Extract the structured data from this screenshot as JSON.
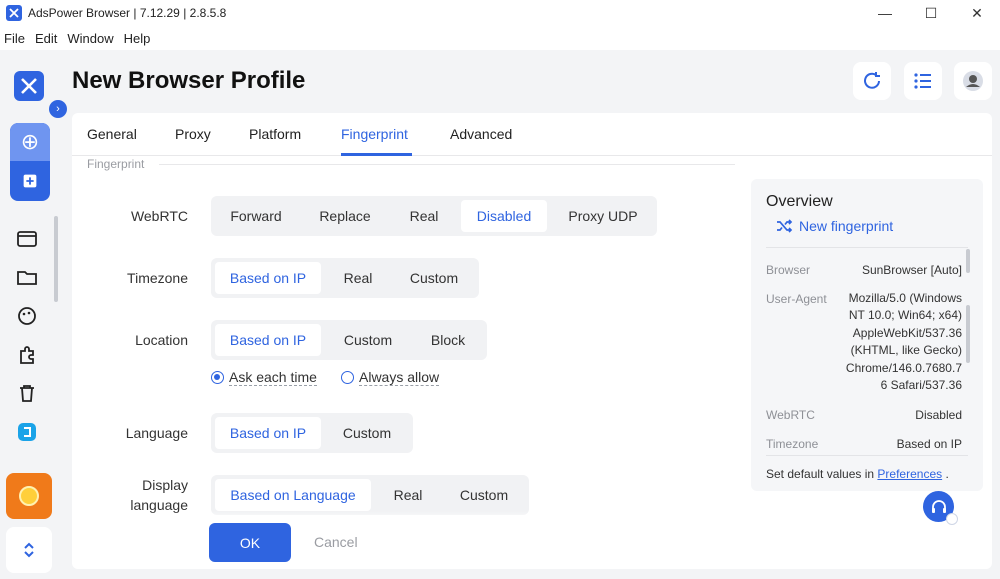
{
  "window": {
    "title": "AdsPower Browser | 7.12.29 | 2.8.5.8"
  },
  "menu": [
    "File",
    "Edit",
    "Window",
    "Help"
  ],
  "header": {
    "title": "New Browser Profile"
  },
  "tabs": [
    "General",
    "Proxy",
    "Platform",
    "Fingerprint",
    "Advanced"
  ],
  "active_tab": "Fingerprint",
  "section_label": "Fingerprint",
  "rows": {
    "webrtc": {
      "label": "WebRTC",
      "options": [
        "Forward",
        "Replace",
        "Real",
        "Disabled",
        "Proxy UDP"
      ],
      "selected": "Disabled"
    },
    "timezone": {
      "label": "Timezone",
      "options": [
        "Based on IP",
        "Real",
        "Custom"
      ],
      "selected": "Based on IP"
    },
    "location": {
      "label": "Location",
      "options": [
        "Based on IP",
        "Custom",
        "Block"
      ],
      "selected": "Based on IP",
      "radios": [
        "Ask each time",
        "Always allow"
      ],
      "radio_selected": "Ask each time"
    },
    "language": {
      "label": "Language",
      "options": [
        "Based on IP",
        "Custom"
      ],
      "selected": "Based on IP"
    },
    "display_language": {
      "label_line1": "Display",
      "label_line2": "language",
      "options": [
        "Based on Language",
        "Real",
        "Custom"
      ],
      "selected": "Based on Language"
    }
  },
  "buttons": {
    "ok": "OK",
    "cancel": "Cancel"
  },
  "overview": {
    "title": "Overview",
    "new_fingerprint": "New fingerprint",
    "items": [
      {
        "key": "Browser",
        "value_lines": [
          "SunBrowser [Auto]"
        ]
      },
      {
        "key": "User-Agent",
        "value_lines": [
          "Mozilla/5.0 (Windows",
          "NT 10.0; Win64; x64)",
          "AppleWebKit/537.36",
          "(KHTML, like Gecko)",
          "Chrome/146.0.7680.7",
          "6 Safari/537.36"
        ]
      },
      {
        "key": "WebRTC",
        "value_lines": [
          "Disabled"
        ]
      },
      {
        "key": "Timezone",
        "value_lines": [
          "Based on IP"
        ]
      }
    ],
    "footer_prefix": "Set default values in",
    "footer_link": "Preferences",
    "footer_suffix": "."
  },
  "colors": {
    "accent": "#2f64e0",
    "promo": "#f07a1a"
  }
}
